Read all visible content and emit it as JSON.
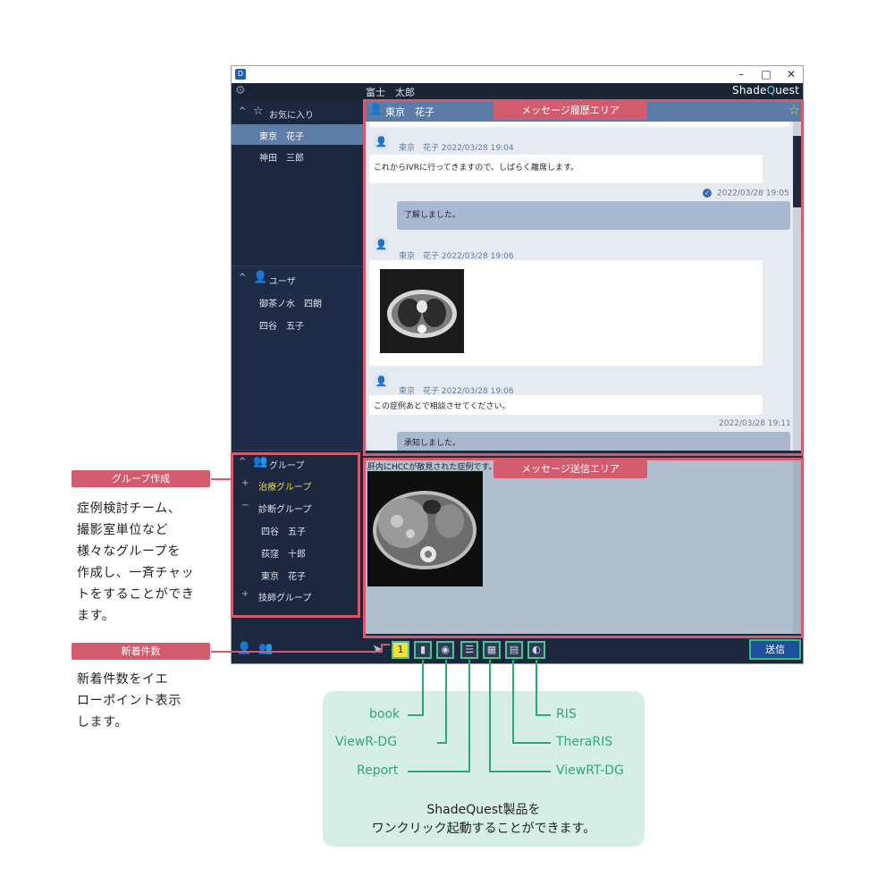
{
  "window": {
    "app_icon": "D",
    "controls": {
      "minimize": "–",
      "maximize": "□",
      "close": "✕"
    },
    "user_name": "富士　太郎",
    "brand_pre": "Shade",
    "brand_q": "Q",
    "brand_post": "uest"
  },
  "sidebar": {
    "favorites": {
      "label": "お気に入り",
      "items": [
        "東京　花子",
        "神田　三郎"
      ]
    },
    "users": {
      "label": "ユーザ",
      "items": [
        "御茶ノ水　四朗",
        "四谷　五子"
      ]
    },
    "groups": {
      "label": "グループ",
      "items": [
        {
          "mark": "+",
          "name": "治療グループ"
        },
        {
          "mark": "−",
          "name": "診断グループ"
        },
        {
          "name": "四谷　五子"
        },
        {
          "name": "荻窪　十郎"
        },
        {
          "name": "東京　花子"
        },
        {
          "mark": "+",
          "name": "技師グループ"
        }
      ]
    }
  },
  "chat": {
    "partner": "東京　花子",
    "messages": [
      {
        "sender": "東京　花子",
        "time": "2022/03/28 19:04",
        "text": "これからIVRに行ってきますので、しばらく離席します。"
      },
      {
        "time": "2022/03/28 19:05",
        "text": "了解しました。"
      },
      {
        "sender": "東京　花子",
        "time": "2022/03/28 19:06"
      },
      {
        "sender": "東京　花子",
        "time": "2022/03/28 19:06",
        "text": "この症例あとで相談させてください。"
      },
      {
        "time": "2022/03/28 19:11",
        "text": "承知しました。"
      }
    ]
  },
  "compose": {
    "draft": "肝内にHCCが散見された症例です。"
  },
  "toolbar": {
    "badge": "1",
    "send_label": "送信"
  },
  "overlays": {
    "history_area": "メッセージ履歴エリア",
    "send_area": "メッセージ送信エリア"
  },
  "callouts": {
    "group": {
      "tag": "グループ作成",
      "lines": [
        "症例検討チーム、",
        "撮影室単位など",
        "様々なグループを",
        "作成し、一斉チャッ",
        "トをすることができ",
        "ます。"
      ]
    },
    "unread": {
      "tag": "新着件数",
      "lines": [
        "新着件数をイエ",
        "ローポイント表示",
        "します。"
      ]
    }
  },
  "legend": {
    "left": [
      "book",
      "ViewR-DG",
      "Report"
    ],
    "right": [
      "RIS",
      "TheraRIS",
      "ViewRT-DG"
    ],
    "caption": [
      "ShadeQuest製品を",
      "ワンクリック起動することができます。"
    ]
  },
  "colors": {
    "accent_pink": "#d25c6d",
    "accent_green": "#2fa777",
    "badge_yellow": "#f3e23a",
    "send_blue": "#1d4f9c"
  },
  "icons": [
    "gear-icon",
    "star-icon",
    "person-icon",
    "group-icon",
    "add-user-icon",
    "add-group-icon",
    "arrow-icon",
    "chat-badge-icon",
    "book-icon",
    "viewr-dg-icon",
    "report-icon",
    "viewrt-dg-icon",
    "theraris-icon",
    "ris-icon"
  ]
}
